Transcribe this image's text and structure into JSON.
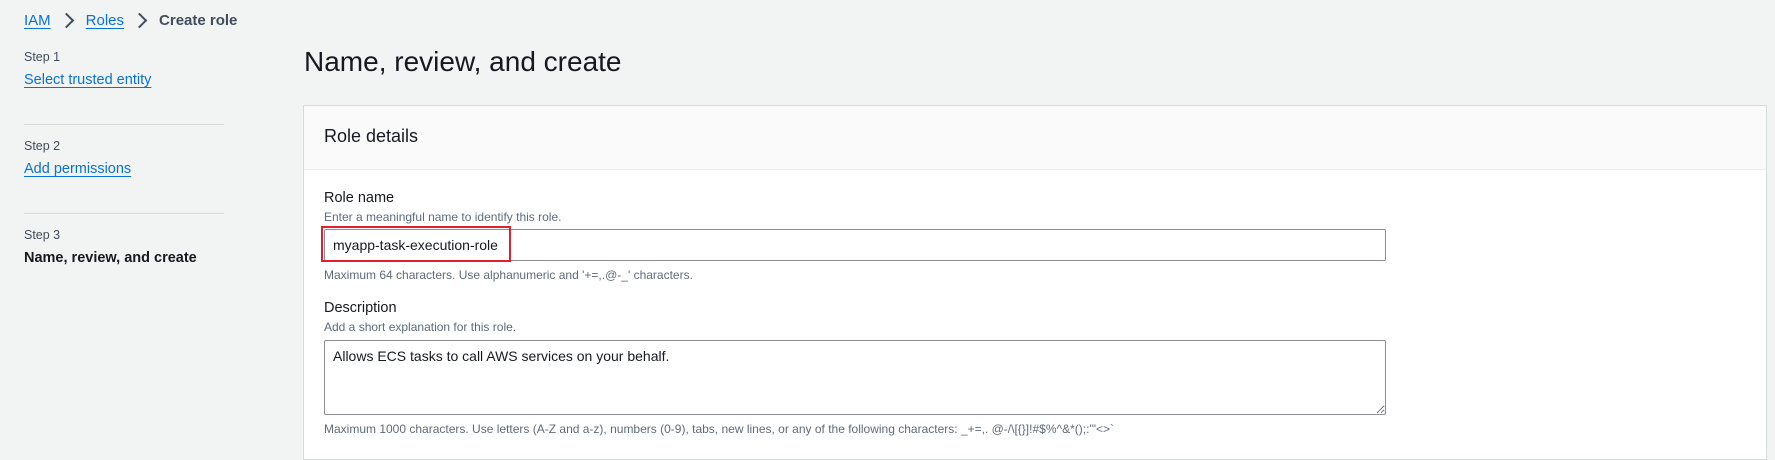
{
  "breadcrumb": {
    "items": [
      "IAM",
      "Roles"
    ],
    "current": "Create role"
  },
  "steps": [
    {
      "number": "Step 1",
      "label": "Select trusted entity"
    },
    {
      "number": "Step 2",
      "label": "Add permissions"
    },
    {
      "number": "Step 3",
      "label": "Name, review, and create"
    }
  ],
  "page": {
    "title": "Name, review, and create"
  },
  "role_details": {
    "title": "Role details",
    "role_name": {
      "label": "Role name",
      "description": "Enter a meaningful name to identify this role.",
      "value": "myapp-task-execution-role",
      "constraint": "Maximum 64 characters. Use alphanumeric and '+=,.@-_' characters."
    },
    "description": {
      "label": "Description",
      "description": "Add a short explanation for this role.",
      "value": "Allows ECS tasks to call AWS services on your behalf.",
      "constraint": "Maximum 1000 characters. Use letters (A-Z and a-z), numbers (0-9), tabs, new lines, or any of the following characters: _+=,. @-/\\[{}]!#$%^&*();:'\"<>`"
    }
  },
  "colors": {
    "link": "#0972d3",
    "highlight": "#e0202e"
  }
}
